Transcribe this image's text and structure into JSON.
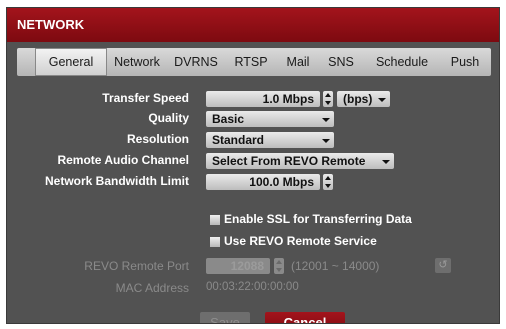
{
  "window": {
    "title": "NETWORK"
  },
  "tabs": [
    "General",
    "Network",
    "DVRNS",
    "RTSP",
    "Mail",
    "SNS",
    "Schedule",
    "Push"
  ],
  "form": {
    "transfer_speed": {
      "label": "Transfer Speed",
      "value": "1.0 Mbps",
      "unit": "(bps)"
    },
    "quality": {
      "label": "Quality",
      "value": "Basic"
    },
    "resolution": {
      "label": "Resolution",
      "value": "Standard"
    },
    "remote_audio": {
      "label": "Remote Audio Channel",
      "value": "Select From REVO Remote"
    },
    "bandwidth_limit": {
      "label": "Network Bandwidth Limit",
      "value": "100.0 Mbps"
    },
    "ssl": {
      "label": "Enable SSL for Transferring Data"
    },
    "revo_service": {
      "label": "Use REVO Remote Service"
    },
    "revo_port": {
      "label": "REVO Remote Port",
      "value": "12088",
      "range": "(12001 ~ 14000)"
    },
    "mac": {
      "label": "MAC Address",
      "value": "00:03:22:00:00:00"
    }
  },
  "buttons": {
    "save": "Save",
    "cancel": "Cancel"
  },
  "colors": {
    "accent": "#9a1118",
    "panel": "#525252",
    "disabled": "#8a8a8a"
  },
  "icons": [
    "spin-up-down-icon",
    "dropdown-caret-icon",
    "checkbox-icon",
    "refresh-icon"
  ]
}
